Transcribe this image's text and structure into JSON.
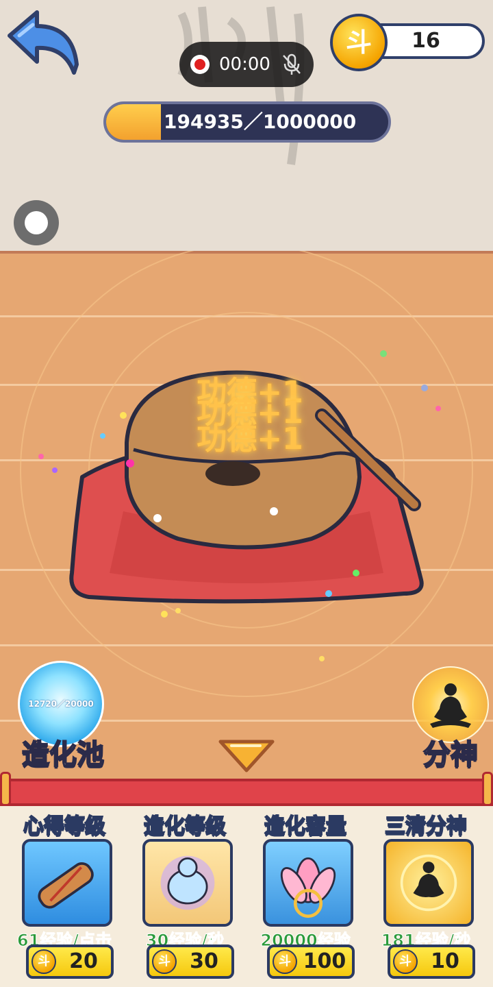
{
  "header": {
    "coin_symbol": "斗",
    "coin_balance": "16",
    "recording_time": "00:00",
    "merit_progress_text": "194935／1000000",
    "merit_progress_fraction": 0.195
  },
  "scene": {
    "merit_popups": [
      "功德+1",
      "功德+1",
      "功德+1"
    ]
  },
  "pool": {
    "value": "12720／20000",
    "label": "造化池"
  },
  "split": {
    "label": "分神"
  },
  "cards": [
    {
      "title": "心得等级",
      "desc": "61经验/点击",
      "price": "20",
      "icon": "scroll-icon"
    },
    {
      "title": "造化等级",
      "desc": "30经验/秒",
      "price": "30",
      "icon": "gourd-icon"
    },
    {
      "title": "造化容量",
      "desc": "20000经验",
      "price": "100",
      "icon": "lotus-icon"
    },
    {
      "title": "三清分神",
      "desc": "181经验/秒",
      "price": "10",
      "icon": "meditation-icon"
    }
  ],
  "colors": {
    "accent_gold": "#f5a400",
    "banner_red": "#e0434a",
    "desc_green": "#2b9a3a",
    "outline_navy": "#2b3a62"
  }
}
